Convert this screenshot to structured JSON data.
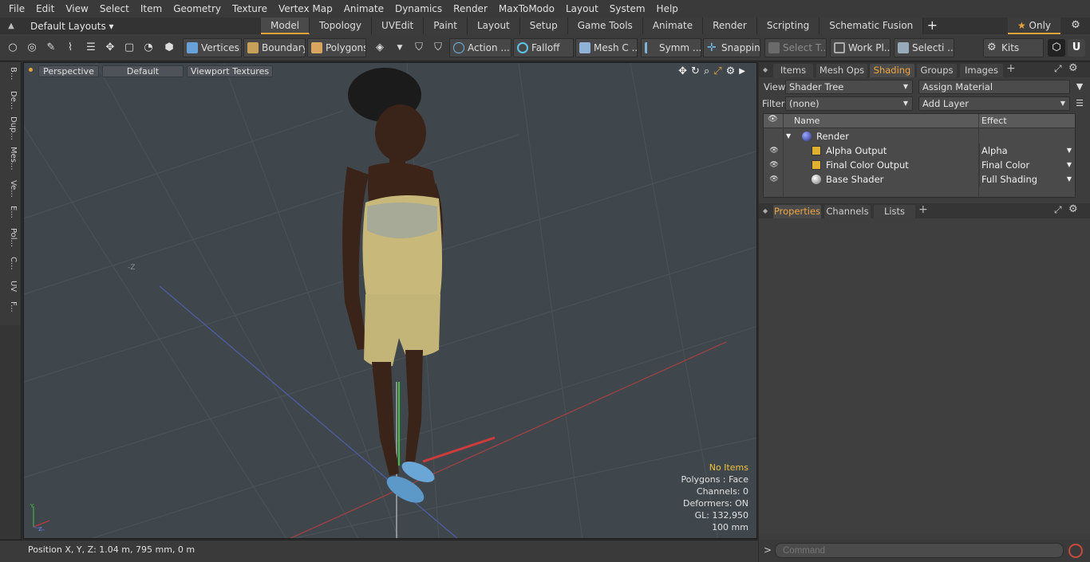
{
  "menu": [
    "File",
    "Edit",
    "View",
    "Select",
    "Item",
    "Geometry",
    "Texture",
    "Vertex Map",
    "Animate",
    "Dynamics",
    "Render",
    "MaxToModo",
    "Layout",
    "System",
    "Help"
  ],
  "layout": {
    "dropdown": "Default Layouts ▾",
    "tabs": [
      "Model",
      "Topology",
      "UVEdit",
      "Paint",
      "Layout",
      "Setup",
      "Game Tools",
      "Animate",
      "Render",
      "Scripting",
      "Schematic Fusion"
    ],
    "active_tab": "Model",
    "only_label": "Only"
  },
  "toolbar": {
    "vertices": "Vertices",
    "boundary": "Boundary",
    "polygons": "Polygons",
    "action": "Action",
    "falloff": "Falloff",
    "mesh": "Mesh C ...",
    "symm": "Symm ...",
    "snapping": "Snapping",
    "select_t": "Select T...",
    "work_pl": "Work Pl...",
    "selecti": "Selecti ...",
    "kits": "Kits"
  },
  "left_tabs": [
    "B...",
    "De...",
    "Dup...",
    "Mes...",
    "Ve...",
    "E...",
    "Pol...",
    "C...",
    "UV",
    "F..."
  ],
  "viewport": {
    "perspective": "Perspective",
    "default": "Default",
    "textures": "Viewport Textures",
    "z_mark": "-Z",
    "stats": {
      "no_items": "No Items",
      "polygons": "Polygons : Face",
      "channels": "Channels: 0",
      "deformers": "Deformers: ON",
      "gl": "GL: 132,950",
      "scale": "100 mm"
    }
  },
  "status": "Position X, Y, Z:   1.04 m, 795 mm, 0 m",
  "right_panel": {
    "tabs": [
      "Items",
      "Mesh Ops",
      "Shading",
      "Groups",
      "Images"
    ],
    "active_tab": "Shading",
    "view_label": "View",
    "view_value": "Shader Tree",
    "assign_material": "Assign Material",
    "filter_label": "Filter",
    "filter_value": "(none)",
    "add_layer": "Add Layer",
    "columns": {
      "name": "Name",
      "effect": "Effect"
    },
    "rows": [
      {
        "name": "Render",
        "effect": ""
      },
      {
        "name": "Alpha Output",
        "effect": "Alpha"
      },
      {
        "name": "Final Color Output",
        "effect": "Final Color"
      },
      {
        "name": "Base Shader",
        "effect": "Full Shading"
      }
    ],
    "prop_tabs": [
      "Properties",
      "Channels",
      "Lists"
    ],
    "active_prop_tab": "Properties"
  },
  "command": {
    "placeholder": "Command"
  },
  "colors": {
    "accent": "#e5a33a",
    "stats_highlight": "#f0c23b",
    "viewport_bg": "#40474c"
  }
}
